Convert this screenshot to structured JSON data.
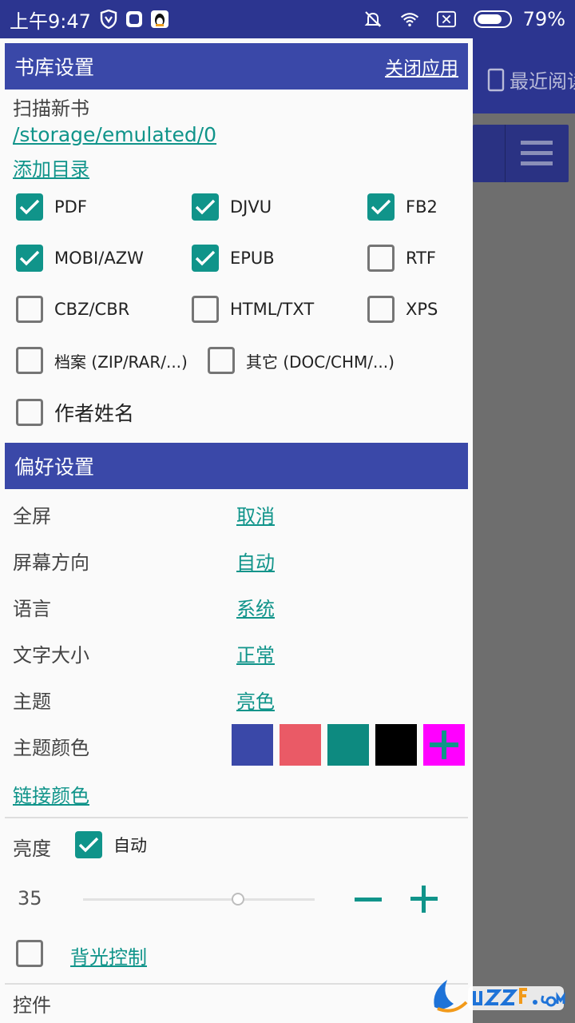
{
  "status_bar": {
    "time": "上午9:47",
    "battery": "79%",
    "battery_level": 0.79
  },
  "background": {
    "recent_label": "最近阅读"
  },
  "library": {
    "title": "书库设置",
    "close_app": "关闭应用",
    "scan_label": "扫描新书",
    "path": "/storage/emulated/0",
    "add_dir": "添加目录",
    "formats": [
      {
        "label": "PDF",
        "checked": true
      },
      {
        "label": "DJVU",
        "checked": true
      },
      {
        "label": "FB2",
        "checked": true
      },
      {
        "label": "MOBI/AZW",
        "checked": true
      },
      {
        "label": "EPUB",
        "checked": true
      },
      {
        "label": "RTF",
        "checked": false
      },
      {
        "label": "CBZ/CBR",
        "checked": false
      },
      {
        "label": "HTML/TXT",
        "checked": false
      },
      {
        "label": "XPS",
        "checked": false
      },
      {
        "label": "档案 (ZIP/RAR/...)",
        "checked": false
      },
      {
        "label": "其它 (DOC/CHM/...)",
        "checked": false
      }
    ],
    "author_name": {
      "label": "作者姓名",
      "checked": false
    }
  },
  "preferences": {
    "title": "偏好设置",
    "rows": [
      {
        "label": "全屏",
        "value": "取消"
      },
      {
        "label": "屏幕方向",
        "value": "自动"
      },
      {
        "label": "语言",
        "value": "系统"
      },
      {
        "label": "文字大小",
        "value": "正常"
      },
      {
        "label": "主题",
        "value": "亮色"
      }
    ],
    "theme_color_label": "主题颜色",
    "theme_colors": [
      "#3a48a8",
      "#ea5a66",
      "#0d8a80",
      "#000000"
    ],
    "add_color_bg": "#ff00ff",
    "link_color_label": "链接颜色",
    "brightness_label": "亮度",
    "brightness_auto_label": "自动",
    "brightness_auto_checked": true,
    "brightness_value": "35",
    "brightness_fraction": 0.67,
    "backlight_label": "背光控制",
    "backlight_checked": false,
    "controls_label": "控件"
  },
  "colors": {
    "accent": "#10948a",
    "header": "#3a48a8",
    "status_bar": "#2c3590"
  }
}
